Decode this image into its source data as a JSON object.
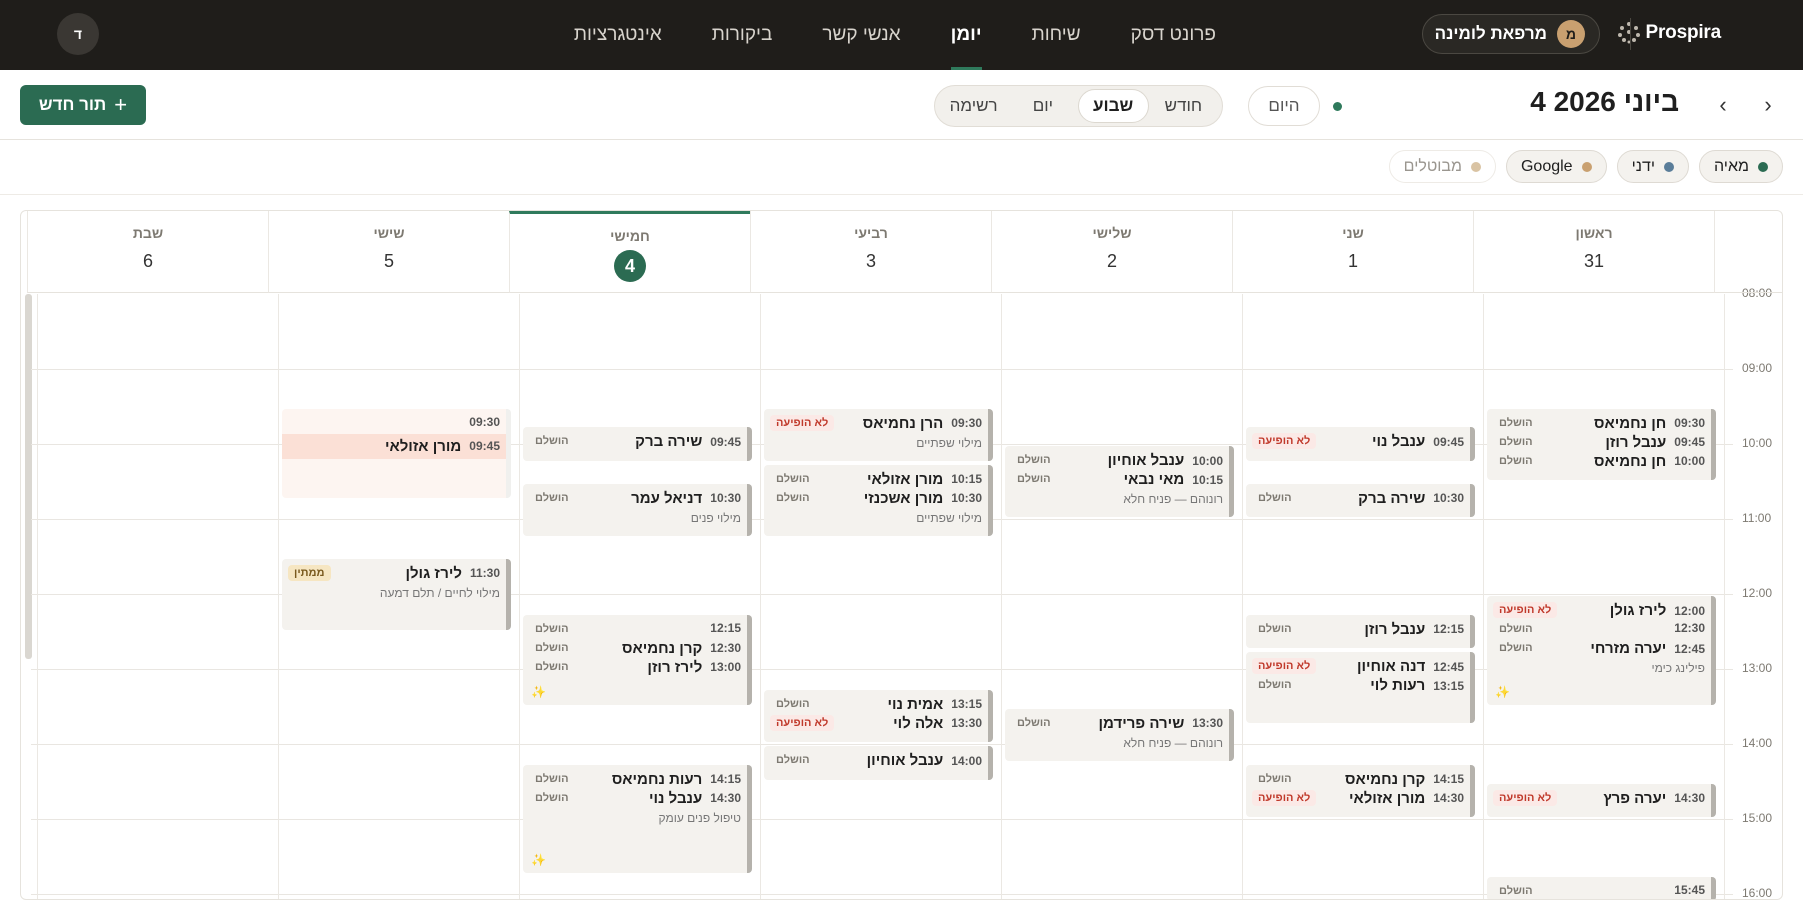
{
  "brand": {
    "name": "Prospira"
  },
  "clinic": {
    "avatar": "מ",
    "name": "מרפאת לומינה"
  },
  "user": {
    "avatar": "ד"
  },
  "nav": [
    {
      "label": "פרונט דסק"
    },
    {
      "label": "שיחות"
    },
    {
      "label": "יומן",
      "active": true
    },
    {
      "label": "אנשי קשר"
    },
    {
      "label": "ביקורות"
    },
    {
      "label": "אינטגרציות"
    }
  ],
  "toolbar": {
    "date_title": "4 ביוני 2026",
    "today": "היום",
    "views": [
      "חודש",
      "שבוע",
      "יום",
      "רשימה"
    ],
    "active_view": "שבוע",
    "new_button": "תור חדש"
  },
  "filters": [
    {
      "label": "מאיה",
      "color": "#2b6b52"
    },
    {
      "label": "ידני",
      "color": "#5a7d99"
    },
    {
      "label": "Google",
      "color": "#c9a070"
    },
    {
      "label": "מבוטלים",
      "color": "#d9c3a3",
      "muted": true
    }
  ],
  "days": [
    {
      "name": "ראשון",
      "num": "31"
    },
    {
      "name": "שני",
      "num": "1"
    },
    {
      "name": "שלישי",
      "num": "2"
    },
    {
      "name": "רביעי",
      "num": "3"
    },
    {
      "name": "חמישי",
      "num": "4",
      "today": true
    },
    {
      "name": "שישי",
      "num": "5"
    },
    {
      "name": "שבת",
      "num": "6"
    }
  ],
  "hours": [
    "08:00",
    "09:00",
    "10:00",
    "11:00",
    "12:00",
    "13:00",
    "14:00",
    "15:00",
    "16:00"
  ],
  "statuses": {
    "done": "הושלם",
    "noshow": "לא הופיעה",
    "waiting": "ממתין"
  },
  "events": [
    {
      "day": 0,
      "start": "09:30",
      "end": "10:30",
      "rows": [
        {
          "time": "09:30",
          "name": "חן נחמיאס"
        },
        {
          "time": "09:45",
          "name": "ענבל רוזן"
        },
        {
          "time": "10:00",
          "name": "חן נחמיאס"
        }
      ],
      "statuses": [
        "done",
        "done",
        "done"
      ]
    },
    {
      "day": 0,
      "start": "12:00",
      "end": "13:30",
      "rows": [
        {
          "time": "12:00",
          "name": "לירז גולן"
        },
        {
          "time": "12:30",
          "name": ""
        },
        {
          "time": "12:45",
          "name": "יערה מזרחי"
        }
      ],
      "sub": "פילינג כימי",
      "statuses": [
        "noshow",
        "done",
        "done"
      ]
    },
    {
      "day": 0,
      "start": "14:30",
      "end": "15:00",
      "rows": [
        {
          "time": "14:30",
          "name": "יערה פרץ"
        }
      ],
      "statuses": [
        "noshow"
      ]
    },
    {
      "day": 0,
      "start": "15:45",
      "end": "16:15",
      "rows": [
        {
          "time": "15:45",
          "name": ""
        }
      ],
      "statuses": [
        "done"
      ]
    },
    {
      "day": 1,
      "start": "09:45",
      "end": "10:15",
      "rows": [
        {
          "time": "09:45",
          "name": "ענבל נוי"
        }
      ],
      "statuses": [
        "noshow"
      ]
    },
    {
      "day": 1,
      "start": "10:30",
      "end": "11:00",
      "rows": [
        {
          "time": "10:30",
          "name": "שירה ברק"
        }
      ],
      "statuses": [
        "done"
      ]
    },
    {
      "day": 1,
      "start": "12:15",
      "end": "12:45",
      "rows": [
        {
          "time": "12:15",
          "name": "ענבל רוזן"
        }
      ],
      "statuses": [
        "done"
      ]
    },
    {
      "day": 1,
      "start": "12:45",
      "end": "13:45",
      "rows": [
        {
          "time": "12:45",
          "name": "דנה אוחיון"
        },
        {
          "time": "13:15",
          "name": "רעות לוי"
        }
      ],
      "statuses": [
        "noshow",
        "done"
      ]
    },
    {
      "day": 1,
      "start": "14:15",
      "end": "15:00",
      "rows": [
        {
          "time": "14:15",
          "name": "קרן נחמיאס"
        },
        {
          "time": "14:30",
          "name": "מורן אזולאי"
        }
      ],
      "statuses": [
        "done",
        "noshow"
      ]
    },
    {
      "day": 2,
      "start": "10:00",
      "end": "11:00",
      "rows": [
        {
          "time": "10:00",
          "name": "ענבל אוחיון"
        },
        {
          "time": "10:15",
          "name": "מאי נבאי"
        }
      ],
      "sub": "רונוהם — פניח חלא",
      "statuses": [
        "done",
        "done"
      ]
    },
    {
      "day": 2,
      "start": "13:30",
      "end": "14:15",
      "rows": [
        {
          "time": "13:30",
          "name": "שירה פרידמן"
        }
      ],
      "sub": "רונוהם — פניח חלא",
      "statuses": [
        "done"
      ]
    },
    {
      "day": 3,
      "start": "09:30",
      "end": "10:15",
      "rows": [
        {
          "time": "09:30",
          "name": "הרן נחמיאס"
        }
      ],
      "sub": "מילוי שפתיים",
      "statuses": [
        "noshow"
      ]
    },
    {
      "day": 3,
      "start": "10:15",
      "end": "11:15",
      "rows": [
        {
          "time": "10:15",
          "name": "מורן אזולאי"
        },
        {
          "time": "10:30",
          "name": "מורן אשכנזי"
        }
      ],
      "sub": "מילוי שפתיים",
      "statuses": [
        "done",
        "done"
      ]
    },
    {
      "day": 3,
      "start": "13:15",
      "end": "14:00",
      "rows": [
        {
          "time": "13:15",
          "name": "אמית נוי"
        },
        {
          "time": "13:30",
          "name": "אלה לוי"
        }
      ],
      "statuses": [
        "done",
        "noshow"
      ]
    },
    {
      "day": 3,
      "start": "14:00",
      "end": "14:30",
      "rows": [
        {
          "time": "14:00",
          "name": "ענבל אוחיון"
        }
      ],
      "statuses": [
        "done"
      ]
    },
    {
      "day": 4,
      "start": "09:45",
      "end": "10:15",
      "rows": [
        {
          "time": "09:45",
          "name": "שירה ברק"
        }
      ],
      "statuses": [
        "done"
      ]
    },
    {
      "day": 4,
      "start": "10:30",
      "end": "11:15",
      "rows": [
        {
          "time": "10:30",
          "name": "דניאל עמר"
        }
      ],
      "sub": "מילוי פנים",
      "statuses": [
        "done"
      ]
    },
    {
      "day": 4,
      "start": "12:15",
      "end": "13:30",
      "rows": [
        {
          "time": "12:15",
          "name": ""
        },
        {
          "time": "12:30",
          "name": "קרן נחמיאס"
        },
        {
          "time": "13:00",
          "name": "לירז רוזן"
        }
      ],
      "statuses": [
        "done",
        "done",
        "done"
      ]
    },
    {
      "day": 4,
      "start": "14:15",
      "end": "15:45",
      "rows": [
        {
          "time": "14:15",
          "name": "רעות נחמיאס"
        },
        {
          "time": "14:30",
          "name": "ענבל נוי"
        }
      ],
      "sub": "טיפול פנים עומק",
      "statuses": [
        "done",
        "done"
      ]
    },
    {
      "day": 5,
      "start": "09:30",
      "end": "10:45",
      "rows": [
        {
          "time": "09:30",
          "name": ""
        },
        {
          "time": "09:45",
          "name": "מורן אזולאי"
        }
      ],
      "highlight": true,
      "statuses": []
    },
    {
      "day": 5,
      "start": "11:30",
      "end": "12:30",
      "rows": [
        {
          "time": "11:30",
          "name": "לירז גולן"
        }
      ],
      "sub": "מילוי לחיים / תלם דמעה",
      "statuses": [
        "waiting"
      ]
    }
  ]
}
